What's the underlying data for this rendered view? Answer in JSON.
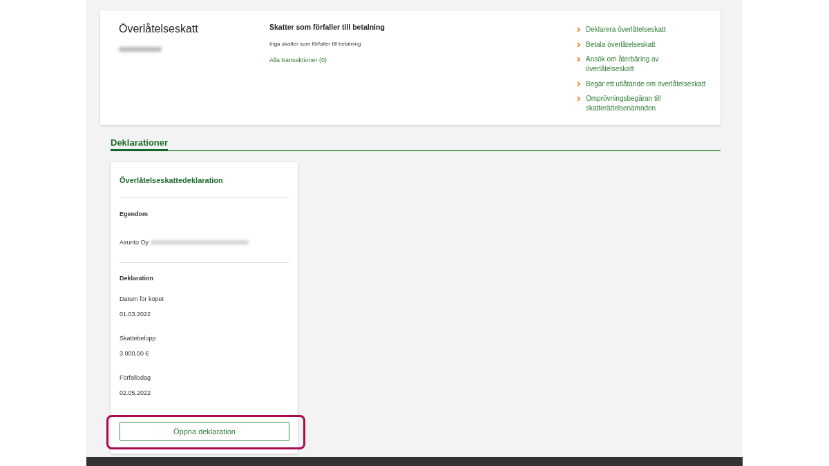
{
  "tax_summary": {
    "title": "Överlåtelseskatt",
    "name_blurred": true,
    "due": {
      "heading": "Skatter som förfaller till betalning",
      "message": "Inga skatter som förfaller till betalning",
      "link": "Alla transaktioner (0)"
    },
    "actions": [
      "Deklarera överlåtelseskatt",
      "Betala överlåtelseskatt",
      "Ansök om återbäring av överlåtelseskatt",
      "Begär ett utlåtande om överlåtelseskatt",
      "Omprövningsbegäran till skatterättelsenämnden"
    ]
  },
  "section": {
    "title": "Deklarationer"
  },
  "declaration_card": {
    "title": "Överlåtelseskattedeklaration",
    "property": {
      "heading": "Egendom",
      "value": "Asunto Oy",
      "value_blurred": true
    },
    "details": {
      "heading": "Deklaration",
      "fields": [
        {
          "label": "Datum för köpet",
          "value": "01.03.2022"
        },
        {
          "label": "Skattebelopp",
          "value": "3 000,00 €"
        },
        {
          "label": "Förfallodag",
          "value": "02.05.2022"
        }
      ]
    },
    "button": {
      "label": "Öppna deklaration",
      "highlighted": true
    }
  }
}
